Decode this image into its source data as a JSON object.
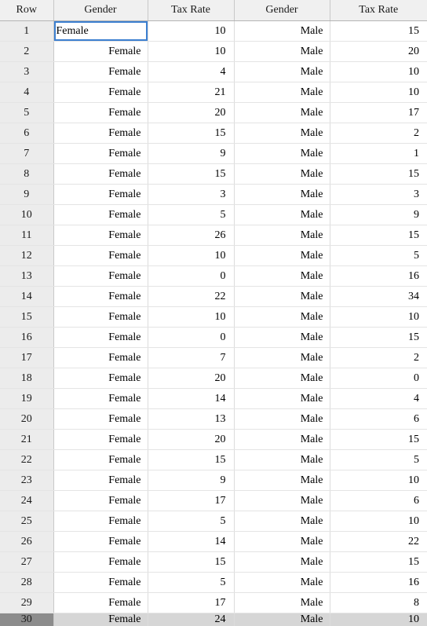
{
  "table": {
    "headers": [
      "Row",
      "Gender",
      "Tax Rate",
      "Gender",
      "Tax Rate"
    ],
    "selected_cell": {
      "row": 1,
      "column": "Gender",
      "value": "Female"
    },
    "rows": [
      {
        "row": "1",
        "gender1": "Female",
        "rate1": "10",
        "gender2": "Male",
        "rate2": "15"
      },
      {
        "row": "2",
        "gender1": "Female",
        "rate1": "10",
        "gender2": "Male",
        "rate2": "20"
      },
      {
        "row": "3",
        "gender1": "Female",
        "rate1": "4",
        "gender2": "Male",
        "rate2": "10"
      },
      {
        "row": "4",
        "gender1": "Female",
        "rate1": "21",
        "gender2": "Male",
        "rate2": "10"
      },
      {
        "row": "5",
        "gender1": "Female",
        "rate1": "20",
        "gender2": "Male",
        "rate2": "17"
      },
      {
        "row": "6",
        "gender1": "Female",
        "rate1": "15",
        "gender2": "Male",
        "rate2": "2"
      },
      {
        "row": "7",
        "gender1": "Female",
        "rate1": "9",
        "gender2": "Male",
        "rate2": "1"
      },
      {
        "row": "8",
        "gender1": "Female",
        "rate1": "15",
        "gender2": "Male",
        "rate2": "15"
      },
      {
        "row": "9",
        "gender1": "Female",
        "rate1": "3",
        "gender2": "Male",
        "rate2": "3"
      },
      {
        "row": "10",
        "gender1": "Female",
        "rate1": "5",
        "gender2": "Male",
        "rate2": "9"
      },
      {
        "row": "11",
        "gender1": "Female",
        "rate1": "26",
        "gender2": "Male",
        "rate2": "15"
      },
      {
        "row": "12",
        "gender1": "Female",
        "rate1": "10",
        "gender2": "Male",
        "rate2": "5"
      },
      {
        "row": "13",
        "gender1": "Female",
        "rate1": "0",
        "gender2": "Male",
        "rate2": "16"
      },
      {
        "row": "14",
        "gender1": "Female",
        "rate1": "22",
        "gender2": "Male",
        "rate2": "34"
      },
      {
        "row": "15",
        "gender1": "Female",
        "rate1": "10",
        "gender2": "Male",
        "rate2": "10"
      },
      {
        "row": "16",
        "gender1": "Female",
        "rate1": "0",
        "gender2": "Male",
        "rate2": "15"
      },
      {
        "row": "17",
        "gender1": "Female",
        "rate1": "7",
        "gender2": "Male",
        "rate2": "2"
      },
      {
        "row": "18",
        "gender1": "Female",
        "rate1": "20",
        "gender2": "Male",
        "rate2": "0"
      },
      {
        "row": "19",
        "gender1": "Female",
        "rate1": "14",
        "gender2": "Male",
        "rate2": "4"
      },
      {
        "row": "20",
        "gender1": "Female",
        "rate1": "13",
        "gender2": "Male",
        "rate2": "6"
      },
      {
        "row": "21",
        "gender1": "Female",
        "rate1": "20",
        "gender2": "Male",
        "rate2": "15"
      },
      {
        "row": "22",
        "gender1": "Female",
        "rate1": "15",
        "gender2": "Male",
        "rate2": "5"
      },
      {
        "row": "23",
        "gender1": "Female",
        "rate1": "9",
        "gender2": "Male",
        "rate2": "10"
      },
      {
        "row": "24",
        "gender1": "Female",
        "rate1": "17",
        "gender2": "Male",
        "rate2": "6"
      },
      {
        "row": "25",
        "gender1": "Female",
        "rate1": "5",
        "gender2": "Male",
        "rate2": "10"
      },
      {
        "row": "26",
        "gender1": "Female",
        "rate1": "14",
        "gender2": "Male",
        "rate2": "22"
      },
      {
        "row": "27",
        "gender1": "Female",
        "rate1": "15",
        "gender2": "Male",
        "rate2": "15"
      },
      {
        "row": "28",
        "gender1": "Female",
        "rate1": "5",
        "gender2": "Male",
        "rate2": "16"
      },
      {
        "row": "29",
        "gender1": "Female",
        "rate1": "17",
        "gender2": "Male",
        "rate2": "8"
      },
      {
        "row": "30",
        "gender1": "Female",
        "rate1": "24",
        "gender2": "Male",
        "rate2": "10"
      }
    ]
  },
  "colors": {
    "header_bg": "#f0f0f0",
    "rowheader_bg": "#ececec",
    "selection_border": "#3c7fd0",
    "partial_row_header_bg": "#8c8c8c",
    "partial_row_bg": "#d6d6d6"
  }
}
